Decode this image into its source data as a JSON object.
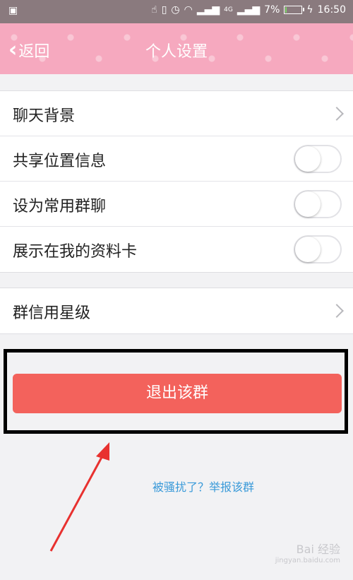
{
  "status_bar": {
    "battery_percent": "7%",
    "battery_level": 0.07,
    "network": "4G",
    "time": "16:50"
  },
  "header": {
    "back_label": "返回",
    "title": "个人设置"
  },
  "settings": {
    "group1": [
      {
        "label": "聊天背景",
        "type": "arrow"
      },
      {
        "label": "共享位置信息",
        "type": "toggle",
        "on": false
      },
      {
        "label": "设为常用群聊",
        "type": "toggle",
        "on": false
      },
      {
        "label": "展示在我的资料卡",
        "type": "toggle",
        "on": false
      }
    ],
    "group2": [
      {
        "label": "群信用星级",
        "type": "arrow"
      }
    ]
  },
  "exit_button": {
    "label": "退出该群"
  },
  "report_link": {
    "label": "被骚扰了？举报该群"
  },
  "watermark": {
    "brand": "Bai 经验",
    "url": "jingyan.baidu.com"
  },
  "colors": {
    "header": "#f6a9bf",
    "exit_button": "#f3625c",
    "link": "#3a9ad9",
    "annotation_arrow": "#e8312f"
  }
}
